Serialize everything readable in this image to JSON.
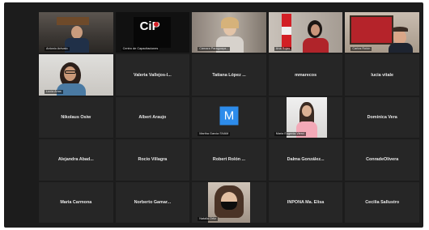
{
  "meeting": {
    "participants": [
      {
        "kind": "video",
        "label": "Antonio Arévalo"
      },
      {
        "kind": "video",
        "label": "Centro de Capacitaciones"
      },
      {
        "kind": "video",
        "label": "Cámara Paraguaya..."
      },
      {
        "kind": "video",
        "label": "Ana Rojas"
      },
      {
        "kind": "video",
        "label": "Carlos Rolón",
        "active": true
      },
      {
        "kind": "video",
        "label": "Lucía Arias"
      },
      {
        "kind": "name",
        "name": "Valeria Vallejos-I..."
      },
      {
        "kind": "name",
        "name": "Tatiana López ..."
      },
      {
        "kind": "name",
        "name": "mmarecos"
      },
      {
        "kind": "name",
        "name": "lucia vitale"
      },
      {
        "kind": "name",
        "name": "Nikolaus Osiw"
      },
      {
        "kind": "name",
        "name": "Albert Araujo"
      },
      {
        "kind": "avatar",
        "initial": "M",
        "label": "Martha Garcia SNAM"
      },
      {
        "kind": "video",
        "label": "Maria Eugenia Vierci"
      },
      {
        "kind": "name",
        "name": "Dominica Vera"
      },
      {
        "kind": "name",
        "name": "Alejandra Abad..."
      },
      {
        "kind": "name",
        "name": "Rocio Villagra"
      },
      {
        "kind": "name",
        "name": "Robert Rolón ..."
      },
      {
        "kind": "name",
        "name": "Dalma González..."
      },
      {
        "kind": "name",
        "name": "ConradeOlivera"
      },
      {
        "kind": "name",
        "name": "Maria Carmona"
      },
      {
        "kind": "name",
        "name": "Norberto Gamar..."
      },
      {
        "kind": "video",
        "label": "Natalia Ortiz"
      },
      {
        "kind": "name",
        "name": "INPONA Ma. Elisa"
      },
      {
        "kind": "name",
        "name": "Cecilia Sallustro"
      }
    ],
    "logo_text": "CiP",
    "accent_active": "#f2e436",
    "mute_color": "#e0403a",
    "avatar_color": "#2d8ceb",
    "icons": {
      "muted": "mic-muted-icon"
    }
  }
}
